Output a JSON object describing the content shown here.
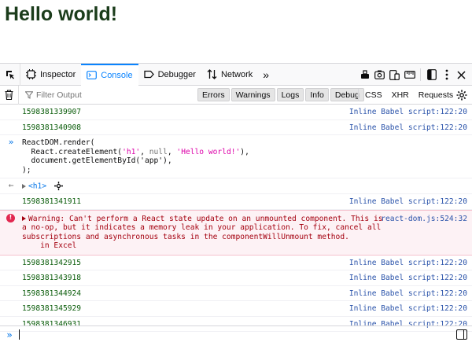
{
  "page": {
    "heading": "Hello world!"
  },
  "toolbar": {
    "tabs": [
      {
        "label": "Inspector",
        "icon": "inspector-icon"
      },
      {
        "label": "Console",
        "icon": "console-icon",
        "selected": true
      },
      {
        "label": "Debugger",
        "icon": "debugger-icon"
      },
      {
        "label": "Network",
        "icon": "network-icon"
      }
    ],
    "more_tabs": "»"
  },
  "filterbar": {
    "placeholder": "Filter Output",
    "levels": [
      "Errors",
      "Warnings",
      "Logs",
      "Info",
      "Debug"
    ],
    "requests": [
      "CSS",
      "XHR",
      "Requests"
    ]
  },
  "messages": {
    "log1": {
      "value": "1598381339907",
      "source": "Inline Babel script:122:20"
    },
    "log2": {
      "value": "1598381340908",
      "source": "Inline Babel script:122:20"
    },
    "input": {
      "line1": "ReactDOM.render(",
      "line2_pre": "  React.createElement(",
      "line2_s1": "'h1'",
      "line2_mid": ", ",
      "line2_null": "null",
      "line2_mid2": ", ",
      "line2_s2": "'Hello world!'",
      "line2_post": "),",
      "line3": "  document.getElementById('app'),",
      "line4": ");"
    },
    "result": {
      "value": "<h1>"
    },
    "log3": {
      "value": "1598381341911",
      "source": "Inline Babel script:122:20"
    },
    "error": {
      "text": "Warning: Can't perform a React state update on an unmounted component. This is a no-op, but it indicates a memory leak in your application. To fix, cancel all subscriptions and asynchronous tasks in the componentWillUnmount method.",
      "trace": "    in Excel",
      "source": "react-dom.js:524:32"
    },
    "log4": {
      "value": "1598381342915",
      "source": "Inline Babel script:122:20"
    },
    "log5": {
      "value": "1598381343918",
      "source": "Inline Babel script:122:20"
    },
    "log6": {
      "value": "1598381344924",
      "source": "Inline Babel script:122:20"
    },
    "log7": {
      "value": "1598381345929",
      "source": "Inline Babel script:122:20"
    },
    "log8": {
      "value": "1598381346931",
      "source": "Inline Babel script:122:20"
    }
  },
  "prompt": {
    "chevron": "»"
  },
  "colors": {
    "accent": "#0a84ff",
    "error_bg": "#fdf2f5",
    "error_text": "#a4000f",
    "source_link": "#2a53aa"
  }
}
